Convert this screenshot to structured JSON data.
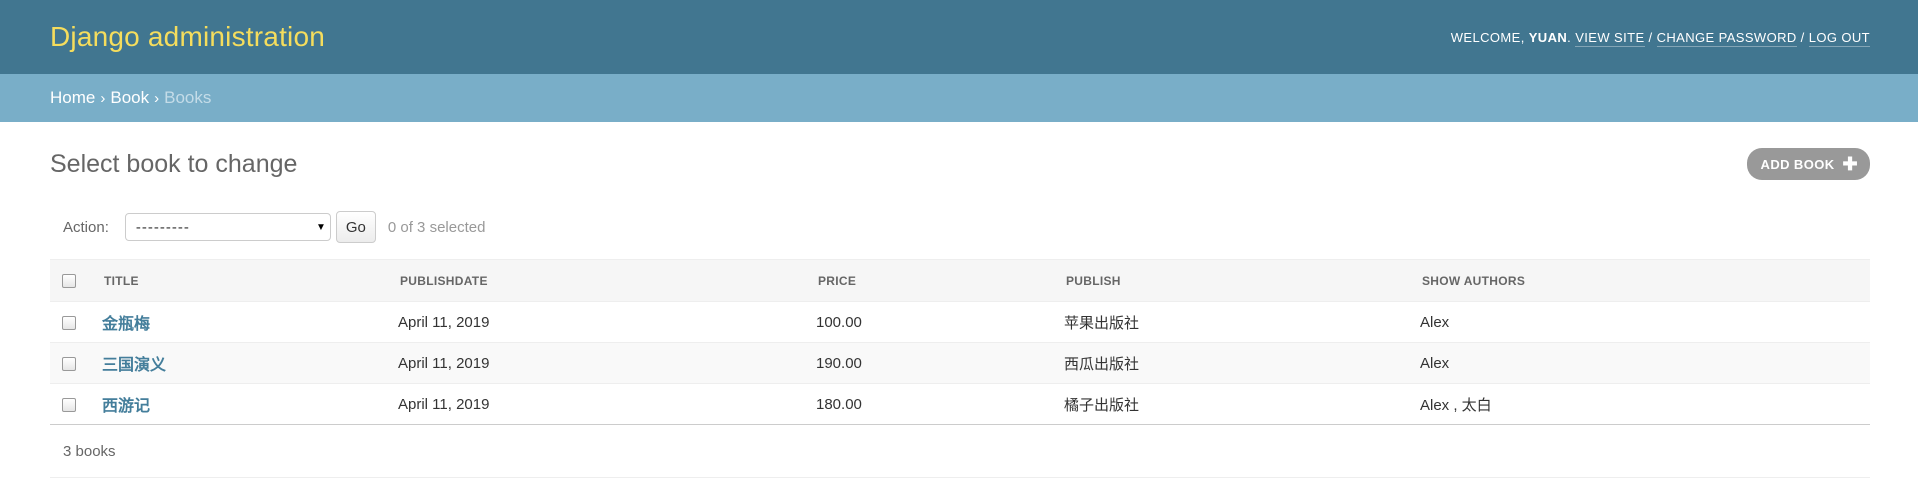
{
  "header": {
    "branding": "Django administration",
    "welcome": "WELCOME,",
    "username": "YUAN",
    "view_site": "VIEW SITE",
    "change_password": "CHANGE PASSWORD",
    "log_out": "LOG OUT"
  },
  "breadcrumbs": {
    "home": "Home",
    "app": "Book",
    "current": "Books"
  },
  "page": {
    "title": "Select book to change",
    "add_button": "ADD BOOK"
  },
  "actions": {
    "label": "Action:",
    "selected_option": "---------",
    "go_label": "Go",
    "selection_status": "0 of 3 selected"
  },
  "table": {
    "columns": [
      "TITLE",
      "PUBLISHDATE",
      "PRICE",
      "PUBLISH",
      "SHOW AUTHORS"
    ],
    "rows": [
      {
        "title": "金瓶梅",
        "publishdate": "April 11, 2019",
        "price": "100.00",
        "publish": "苹果出版社",
        "authors": "Alex"
      },
      {
        "title": "三国演义",
        "publishdate": "April 11, 2019",
        "price": "190.00",
        "publish": "西瓜出版社",
        "authors": "Alex"
      },
      {
        "title": "西游记",
        "publishdate": "April 11, 2019",
        "price": "180.00",
        "publish": "橘子出版社",
        "authors": "Alex , 太白"
      }
    ]
  },
  "paginator": {
    "count_text": "3 books"
  },
  "colors": {
    "header_bg": "#417690",
    "branding": "#f5dd5d",
    "breadcrumbs_bg": "#79aec8",
    "link": "#447e9b",
    "add_button_bg": "#999999"
  }
}
